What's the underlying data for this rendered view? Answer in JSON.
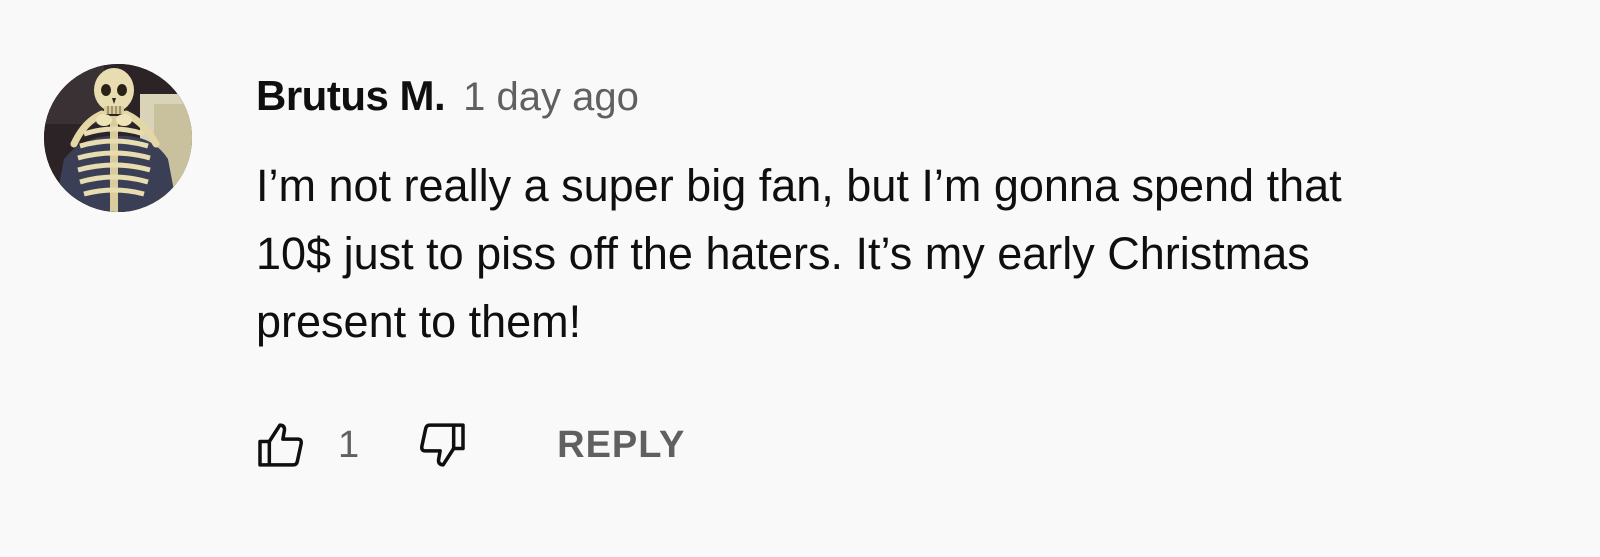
{
  "comment": {
    "author": "Brutus M.",
    "timestamp": "1 day ago",
    "text": "I’m not really a super big fan, but I’m gonna spend that\n10$ just to piss off the haters. It’s my early Christmas\npresent to them!",
    "avatar_icon": "skeleton-avatar",
    "like_icon": "thumbs-up-icon",
    "like_count": "1",
    "dislike_icon": "thumbs-down-icon",
    "reply_label": "REPLY"
  },
  "colors": {
    "background": "#f9f9f9",
    "text_primary": "#0f0f0f",
    "text_secondary": "#606060"
  }
}
